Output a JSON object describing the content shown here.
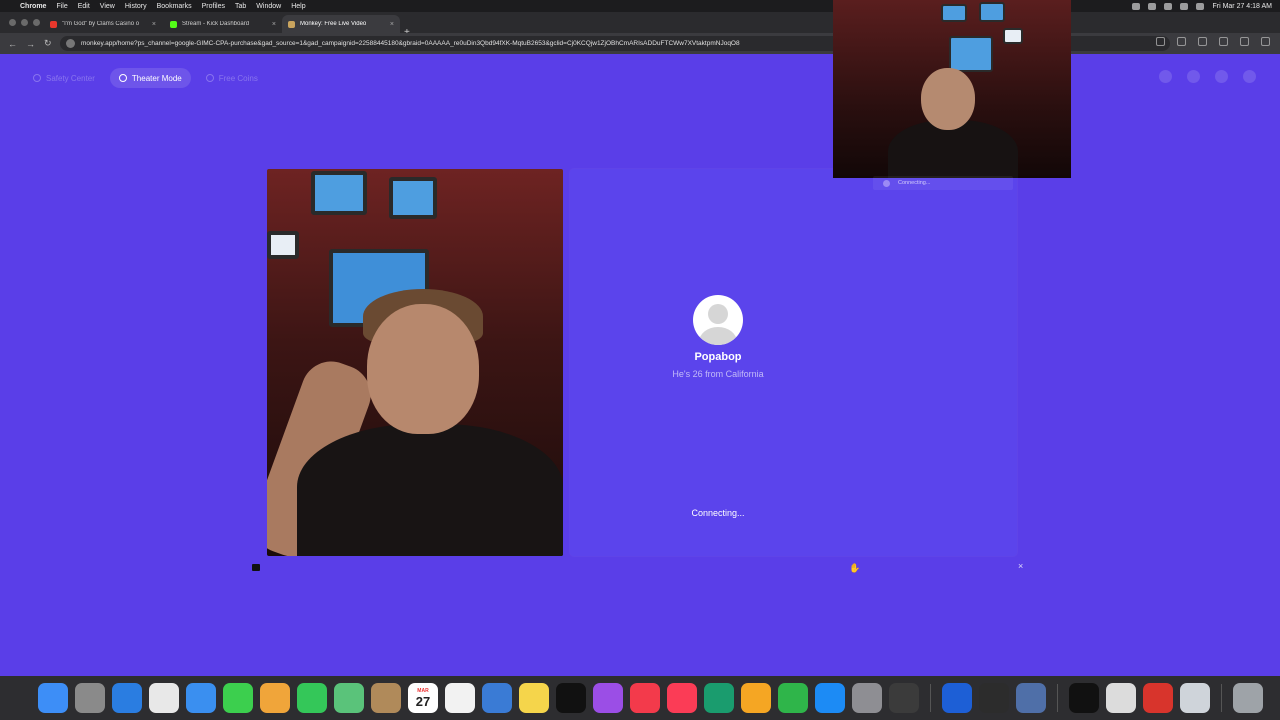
{
  "menubar": {
    "app": "Chrome",
    "items": [
      "File",
      "Edit",
      "View",
      "History",
      "Bookmarks",
      "Profiles",
      "Tab",
      "Window",
      "Help"
    ],
    "clock": "Fri Mar 27  4:18 AM"
  },
  "tabs": [
    {
      "title": "\"I'm God\" by Clams Casino o",
      "favicon_color": "#e8372c"
    },
    {
      "title": "Stream - Kick Dashboard",
      "favicon_color": "#53fc18"
    },
    {
      "title": "Monkey: Free Live Video",
      "favicon_color": "#c9a45e"
    }
  ],
  "address": {
    "url": "monkey.app/home?ps_channel=google-GIMC-CPA-purchase&gad_source=1&gad_campaignid=22588445180&gbraid=0AAAAA_re0uDin3Qbd94fXK-MqtuB2653&gclid=Cj0KCQjw1ZjOBhCmARIsADDuFTCWw7XVtaktpmNJoqO8"
  },
  "nav": {
    "safety": "Safety Center",
    "theater": "Theater Mode",
    "coins": "Free Coins"
  },
  "match": {
    "name": "Popabop",
    "info": "He's 26 from California",
    "status": "Connecting..."
  },
  "pip": {
    "status": "Connecting..."
  },
  "calendar": {
    "month": "MAR",
    "day": "27"
  },
  "dock": [
    {
      "name": "finder",
      "color": "#3d8ef7"
    },
    {
      "name": "launchpad",
      "color": "#8a8a8a"
    },
    {
      "name": "safari",
      "color": "#2a7de1"
    },
    {
      "name": "chrome",
      "color": "#e8e8e8"
    },
    {
      "name": "mail",
      "color": "#3a8ff0"
    },
    {
      "name": "messages",
      "color": "#3ccf4e"
    },
    {
      "name": "photos",
      "color": "#f0a53a"
    },
    {
      "name": "facetime",
      "color": "#34c759"
    },
    {
      "name": "maps",
      "color": "#5ac37a"
    },
    {
      "name": "contacts",
      "color": "#b08a5a"
    },
    {
      "name": "calendar",
      "color": "#ffffff"
    },
    {
      "name": "reminders",
      "color": "#f2f2f2"
    },
    {
      "name": "keynote",
      "color": "#3a7bd5"
    },
    {
      "name": "notes",
      "color": "#f5d54b"
    },
    {
      "name": "tv",
      "color": "#111111"
    },
    {
      "name": "podcasts",
      "color": "#9b4ee6"
    },
    {
      "name": "news",
      "color": "#f33a4b"
    },
    {
      "name": "music",
      "color": "#fb3c56"
    },
    {
      "name": "affinity",
      "color": "#1a9c6e"
    },
    {
      "name": "pages",
      "color": "#f5a623"
    },
    {
      "name": "numbers",
      "color": "#2fb54a"
    },
    {
      "name": "app-store",
      "color": "#1c8bf5"
    },
    {
      "name": "settings",
      "color": "#8e8e93"
    },
    {
      "name": "final-cut",
      "color": "#3b3b3b"
    },
    {
      "name": "quicktime",
      "color": "#1d5fd6"
    },
    {
      "name": "obs",
      "color": "#2c2c2c"
    },
    {
      "name": "preview",
      "color": "#4f6fa8"
    },
    {
      "name": "capcut",
      "color": "#111111"
    },
    {
      "name": "music-file",
      "color": "#dcdcdc"
    },
    {
      "name": "pdf",
      "color": "#d8342c"
    },
    {
      "name": "finder-window",
      "color": "#cfd4da"
    },
    {
      "name": "trash",
      "color": "#9ea3a8"
    }
  ],
  "colors": {
    "page_bg": "#5a3ee8",
    "panel": "#5b44ec"
  }
}
